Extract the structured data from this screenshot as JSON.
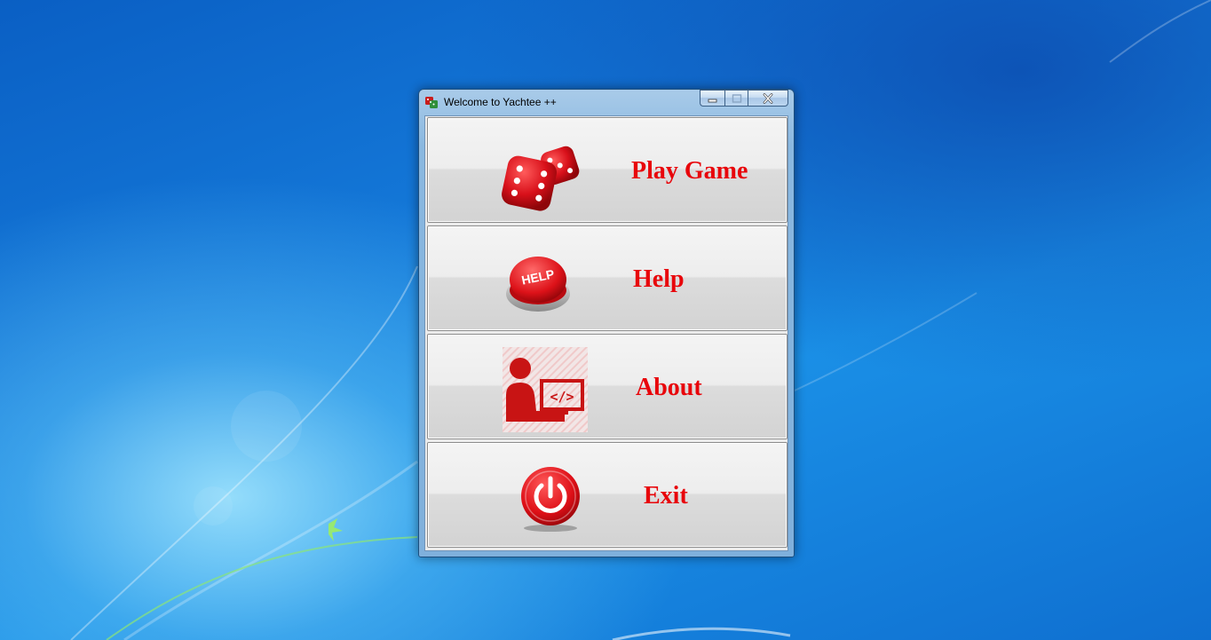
{
  "window": {
    "title": "Welcome to Yachtee ++",
    "icon": "yachtee-app-icon",
    "controls": [
      "minimize-icon",
      "maximize-icon",
      "close-icon"
    ]
  },
  "menu": {
    "items": [
      {
        "label": "Play Game",
        "icon": "dice-icon"
      },
      {
        "label": "Help",
        "icon": "help-button-icon"
      },
      {
        "label": "About",
        "icon": "developer-icon"
      },
      {
        "label": "Exit",
        "icon": "power-icon"
      }
    ]
  },
  "colors": {
    "label_red": "#e8060b",
    "button_face": "#ececec",
    "desktop_blue": "#1478d8"
  }
}
